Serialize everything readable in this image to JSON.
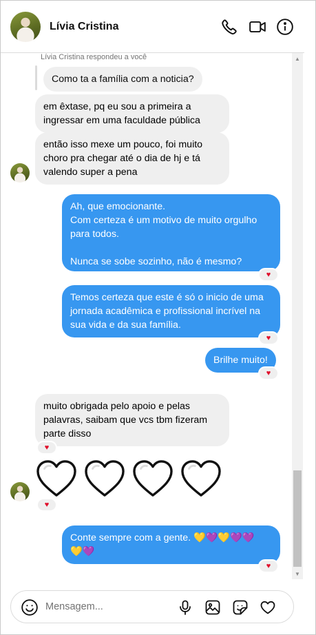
{
  "header": {
    "contact_name": "Lívia Cristina",
    "icons": [
      "phone-icon",
      "video-camera-icon",
      "info-icon"
    ]
  },
  "thread": {
    "reply_note": "Lívia Cristina respondeu a você",
    "quoted_message": "Como ta a família com a noticia?",
    "messages": [
      {
        "from": "them",
        "text": "em êxtase, pq eu sou a primeira a\ningressar em uma faculdade pública"
      },
      {
        "from": "them",
        "text": "então isso mexe um pouco, foi muito\nchoro pra chegar até o dia de hj e tá\nvalendo super a pena"
      },
      {
        "from": "me",
        "text": "Ah, que emocionante.\nCom certeza é um motivo de muito orgulho\npara todos.\n\nNunca se sobe sozinho, não é mesmo?",
        "reaction": "♥"
      },
      {
        "from": "me",
        "text": "Temos certeza que este é só o inicio de uma\njornada acadêmica e profissional incrível na\nsua vida e da sua família.",
        "reaction": "♥"
      },
      {
        "from": "me",
        "text": "Brilhe muito!",
        "reaction": "♥"
      },
      {
        "from": "them",
        "text": "muito obrigada pelo apoio e pelas\npalavras, saibam que vcs tbm fizeram\nparte disso",
        "reaction": "♥"
      },
      {
        "from": "them",
        "type": "hearts",
        "count": 4,
        "reaction": "♥"
      },
      {
        "from": "me",
        "text": "Conte sempre com a gente. 💛💜💛💜💜\n💛💜",
        "reaction": "♥"
      }
    ]
  },
  "composer": {
    "placeholder": "Mensagem...",
    "icons": [
      "emoji-icon",
      "microphone-icon",
      "image-icon",
      "sticker-icon",
      "heart-icon"
    ]
  },
  "colors": {
    "outgoing_bubble": "#3797f0",
    "incoming_bubble": "#efefef",
    "reaction_heart": "#e0102c"
  }
}
